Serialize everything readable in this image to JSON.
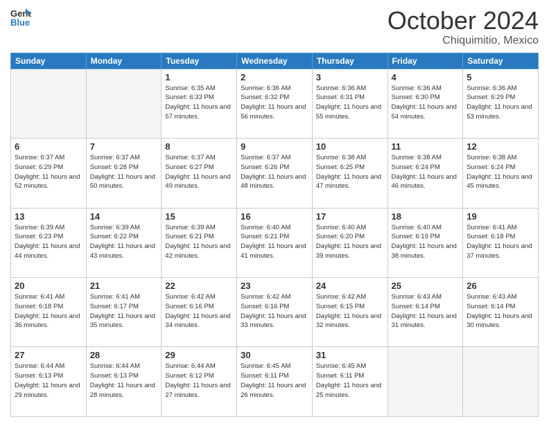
{
  "header": {
    "logo_line1": "General",
    "logo_line2": "Blue",
    "month": "October 2024",
    "location": "Chiquimitio, Mexico"
  },
  "weekdays": [
    "Sunday",
    "Monday",
    "Tuesday",
    "Wednesday",
    "Thursday",
    "Friday",
    "Saturday"
  ],
  "weeks": [
    [
      {
        "day": "",
        "info": ""
      },
      {
        "day": "",
        "info": ""
      },
      {
        "day": "1",
        "sunrise": "Sunrise: 6:35 AM",
        "sunset": "Sunset: 6:33 PM",
        "daylight": "Daylight: 11 hours and 57 minutes."
      },
      {
        "day": "2",
        "sunrise": "Sunrise: 6:36 AM",
        "sunset": "Sunset: 6:32 PM",
        "daylight": "Daylight: 11 hours and 56 minutes."
      },
      {
        "day": "3",
        "sunrise": "Sunrise: 6:36 AM",
        "sunset": "Sunset: 6:31 PM",
        "daylight": "Daylight: 11 hours and 55 minutes."
      },
      {
        "day": "4",
        "sunrise": "Sunrise: 6:36 AM",
        "sunset": "Sunset: 6:30 PM",
        "daylight": "Daylight: 11 hours and 54 minutes."
      },
      {
        "day": "5",
        "sunrise": "Sunrise: 6:36 AM",
        "sunset": "Sunset: 6:29 PM",
        "daylight": "Daylight: 11 hours and 53 minutes."
      }
    ],
    [
      {
        "day": "6",
        "sunrise": "Sunrise: 6:37 AM",
        "sunset": "Sunset: 6:29 PM",
        "daylight": "Daylight: 11 hours and 52 minutes."
      },
      {
        "day": "7",
        "sunrise": "Sunrise: 6:37 AM",
        "sunset": "Sunset: 6:28 PM",
        "daylight": "Daylight: 11 hours and 50 minutes."
      },
      {
        "day": "8",
        "sunrise": "Sunrise: 6:37 AM",
        "sunset": "Sunset: 6:27 PM",
        "daylight": "Daylight: 11 hours and 49 minutes."
      },
      {
        "day": "9",
        "sunrise": "Sunrise: 6:37 AM",
        "sunset": "Sunset: 6:26 PM",
        "daylight": "Daylight: 11 hours and 48 minutes."
      },
      {
        "day": "10",
        "sunrise": "Sunrise: 6:38 AM",
        "sunset": "Sunset: 6:25 PM",
        "daylight": "Daylight: 11 hours and 47 minutes."
      },
      {
        "day": "11",
        "sunrise": "Sunrise: 6:38 AM",
        "sunset": "Sunset: 6:24 PM",
        "daylight": "Daylight: 11 hours and 46 minutes."
      },
      {
        "day": "12",
        "sunrise": "Sunrise: 6:38 AM",
        "sunset": "Sunset: 6:24 PM",
        "daylight": "Daylight: 11 hours and 45 minutes."
      }
    ],
    [
      {
        "day": "13",
        "sunrise": "Sunrise: 6:39 AM",
        "sunset": "Sunset: 6:23 PM",
        "daylight": "Daylight: 11 hours and 44 minutes."
      },
      {
        "day": "14",
        "sunrise": "Sunrise: 6:39 AM",
        "sunset": "Sunset: 6:22 PM",
        "daylight": "Daylight: 11 hours and 43 minutes."
      },
      {
        "day": "15",
        "sunrise": "Sunrise: 6:39 AM",
        "sunset": "Sunset: 6:21 PM",
        "daylight": "Daylight: 11 hours and 42 minutes."
      },
      {
        "day": "16",
        "sunrise": "Sunrise: 6:40 AM",
        "sunset": "Sunset: 6:21 PM",
        "daylight": "Daylight: 11 hours and 41 minutes."
      },
      {
        "day": "17",
        "sunrise": "Sunrise: 6:40 AM",
        "sunset": "Sunset: 6:20 PM",
        "daylight": "Daylight: 11 hours and 39 minutes."
      },
      {
        "day": "18",
        "sunrise": "Sunrise: 6:40 AM",
        "sunset": "Sunset: 6:19 PM",
        "daylight": "Daylight: 11 hours and 38 minutes."
      },
      {
        "day": "19",
        "sunrise": "Sunrise: 6:41 AM",
        "sunset": "Sunset: 6:18 PM",
        "daylight": "Daylight: 11 hours and 37 minutes."
      }
    ],
    [
      {
        "day": "20",
        "sunrise": "Sunrise: 6:41 AM",
        "sunset": "Sunset: 6:18 PM",
        "daylight": "Daylight: 11 hours and 36 minutes."
      },
      {
        "day": "21",
        "sunrise": "Sunrise: 6:41 AM",
        "sunset": "Sunset: 6:17 PM",
        "daylight": "Daylight: 11 hours and 35 minutes."
      },
      {
        "day": "22",
        "sunrise": "Sunrise: 6:42 AM",
        "sunset": "Sunset: 6:16 PM",
        "daylight": "Daylight: 11 hours and 34 minutes."
      },
      {
        "day": "23",
        "sunrise": "Sunrise: 6:42 AM",
        "sunset": "Sunset: 6:16 PM",
        "daylight": "Daylight: 11 hours and 33 minutes."
      },
      {
        "day": "24",
        "sunrise": "Sunrise: 6:42 AM",
        "sunset": "Sunset: 6:15 PM",
        "daylight": "Daylight: 11 hours and 32 minutes."
      },
      {
        "day": "25",
        "sunrise": "Sunrise: 6:43 AM",
        "sunset": "Sunset: 6:14 PM",
        "daylight": "Daylight: 11 hours and 31 minutes."
      },
      {
        "day": "26",
        "sunrise": "Sunrise: 6:43 AM",
        "sunset": "Sunset: 6:14 PM",
        "daylight": "Daylight: 11 hours and 30 minutes."
      }
    ],
    [
      {
        "day": "27",
        "sunrise": "Sunrise: 6:44 AM",
        "sunset": "Sunset: 6:13 PM",
        "daylight": "Daylight: 11 hours and 29 minutes."
      },
      {
        "day": "28",
        "sunrise": "Sunrise: 6:44 AM",
        "sunset": "Sunset: 6:13 PM",
        "daylight": "Daylight: 11 hours and 28 minutes."
      },
      {
        "day": "29",
        "sunrise": "Sunrise: 6:44 AM",
        "sunset": "Sunset: 6:12 PM",
        "daylight": "Daylight: 11 hours and 27 minutes."
      },
      {
        "day": "30",
        "sunrise": "Sunrise: 6:45 AM",
        "sunset": "Sunset: 6:11 PM",
        "daylight": "Daylight: 11 hours and 26 minutes."
      },
      {
        "day": "31",
        "sunrise": "Sunrise: 6:45 AM",
        "sunset": "Sunset: 6:11 PM",
        "daylight": "Daylight: 11 hours and 25 minutes."
      },
      {
        "day": "",
        "info": ""
      },
      {
        "day": "",
        "info": ""
      }
    ]
  ]
}
